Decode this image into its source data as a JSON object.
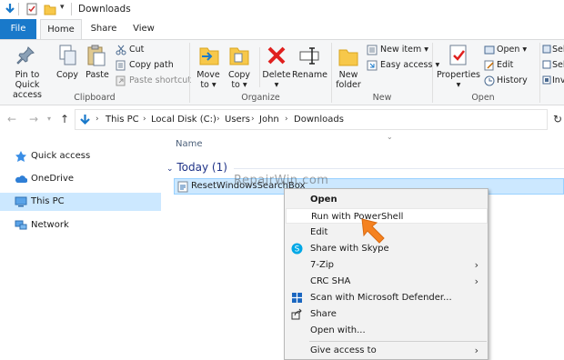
{
  "window": {
    "title": "Downloads"
  },
  "tabs": {
    "file": "File",
    "home": "Home",
    "share": "Share",
    "view": "View"
  },
  "ribbon": {
    "clipboard": {
      "pin_label_1": "Pin to Quick",
      "pin_label_2": "access",
      "copy": "Copy",
      "paste": "Paste",
      "cut": "Cut",
      "copy_path": "Copy path",
      "paste_shortcut": "Paste shortcut",
      "group": "Clipboard"
    },
    "organize": {
      "move_to_1": "Move",
      "move_to_2": "to ▾",
      "copy_to_1": "Copy",
      "copy_to_2": "to ▾",
      "delete_1": "Delete",
      "delete_2": "▾",
      "rename": "Rename",
      "group": "Organize"
    },
    "new": {
      "new_folder_1": "New",
      "new_folder_2": "folder",
      "new_item": "New item ▾",
      "easy_access": "Easy access ▾",
      "group": "New"
    },
    "open": {
      "properties_1": "Properties",
      "properties_2": "▾",
      "open": "Open ▾",
      "edit": "Edit",
      "history": "History",
      "group": "Open"
    },
    "select": {
      "s1": "Sele",
      "s2": "Sele",
      "s3": "Inve"
    }
  },
  "address": {
    "crumbs": [
      "This PC",
      "Local Disk (C:)",
      "Users",
      "John",
      "Downloads"
    ]
  },
  "sidebar": {
    "items": [
      {
        "label": "Quick access",
        "icon": "star-icon"
      },
      {
        "label": "OneDrive",
        "icon": "cloud-icon"
      },
      {
        "label": "This PC",
        "icon": "computer-icon"
      },
      {
        "label": "Network",
        "icon": "network-icon"
      }
    ]
  },
  "content": {
    "column_name": "Name",
    "group_header": "Today (1)",
    "file_name": "ResetWindowsSearchBox",
    "watermark": "RepairWin.com"
  },
  "context_menu": {
    "items": [
      {
        "label": "Open",
        "bold": true
      },
      {
        "label": "Run with PowerShell",
        "highlighted": true
      },
      {
        "label": "Edit"
      },
      {
        "label": "Share with Skype",
        "icon": "skype-icon"
      },
      {
        "label": "7-Zip",
        "submenu": true
      },
      {
        "label": "CRC SHA",
        "submenu": true
      },
      {
        "label": "Scan with Microsoft Defender...",
        "icon": "defender-icon"
      },
      {
        "label": "Share",
        "icon": "share-icon"
      },
      {
        "label": "Open with..."
      },
      {
        "label": "Give access to",
        "submenu": true
      }
    ]
  },
  "colors": {
    "accent": "#1979ca",
    "selection": "#cce8ff",
    "pointer_arrow": "#f58220"
  }
}
